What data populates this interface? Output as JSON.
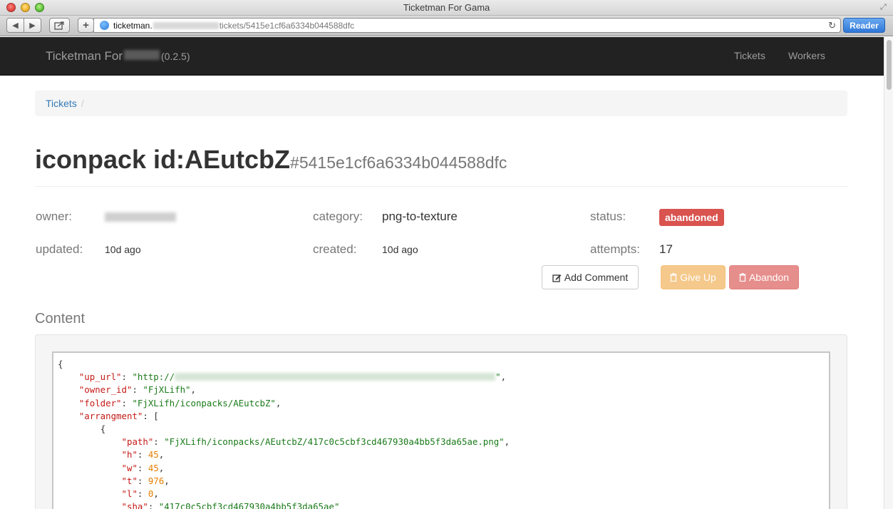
{
  "window": {
    "title": "Ticketman For Gama"
  },
  "browser": {
    "url_host": "ticketman.",
    "url_path": "tickets/5415e1cf6a6334b044588dfc",
    "reader_label": "Reader"
  },
  "navbar": {
    "brand": "Ticketman For",
    "version": "(0.2.5)",
    "links": [
      "Tickets",
      "Workers"
    ]
  },
  "breadcrumb": {
    "item": "Tickets",
    "separator": "/"
  },
  "ticket": {
    "title": "iconpack id:AEutcbZ",
    "id": "#5415e1cf6a6334b044588dfc",
    "fields": {
      "owner_label": "owner:",
      "category_label": "category:",
      "category_value": "png-to-texture",
      "status_label": "status:",
      "status_value": "abandoned",
      "updated_label": "updated:",
      "updated_value": "10d ago",
      "created_label": "created:",
      "created_value": "10d ago",
      "attempts_label": "attempts:",
      "attempts_value": "17"
    },
    "actions": {
      "add_comment": "Add Comment",
      "give_up": "Give Up",
      "abandon": "Abandon"
    },
    "status_color": "#d9534f"
  },
  "content": {
    "heading": "Content",
    "json_lines": {
      "open": "{",
      "up_url_key": "\"up_url\"",
      "up_url_prefix": "\"http://",
      "up_url_suffix": "\"",
      "owner_id_key": "\"owner_id\"",
      "owner_id_value": "\"FjXLifh\"",
      "folder_key": "\"folder\"",
      "folder_value": "\"FjXLifh/iconpacks/AEutcbZ\"",
      "arrangment_key": "\"arrangment\"",
      "arr_open": "[",
      "obj_open": "{",
      "path_key": "\"path\"",
      "path_value": "\"FjXLifh/iconpacks/AEutcbZ/417c0c5cbf3cd467930a4bb5f3da65ae.png\"",
      "h_key": "\"h\"",
      "h_value": "45",
      "w_key": "\"w\"",
      "w_value": "45",
      "t_key": "\"t\"",
      "t_value": "976",
      "l_key": "\"l\"",
      "l_value": "0",
      "sha_key": "\"sha\"",
      "sha_value": "\"417c0c5cbf3cd467930a4bb5f3da65ae\""
    }
  }
}
